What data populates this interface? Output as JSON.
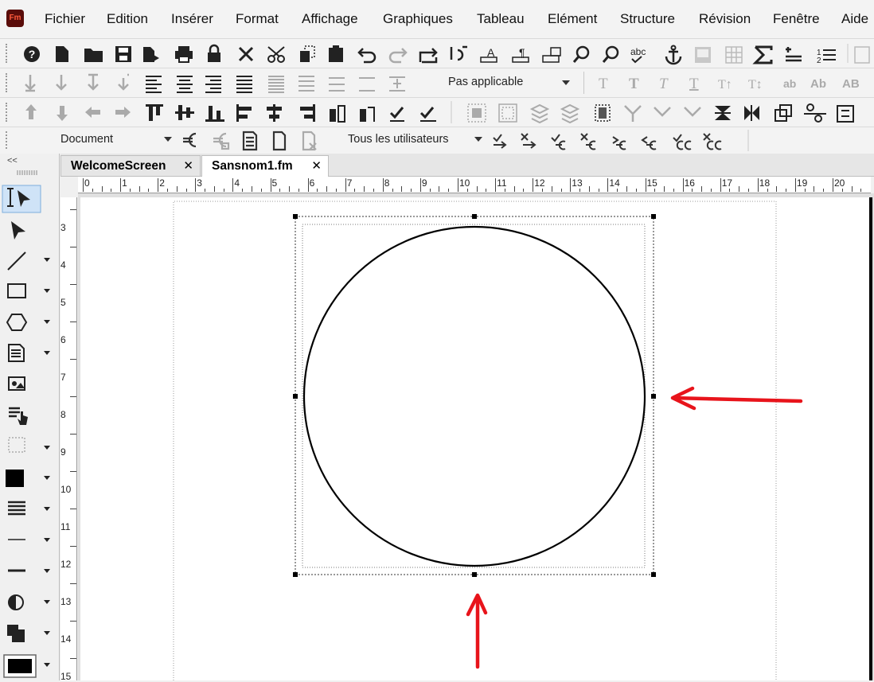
{
  "app": {
    "logo_text": "Fm"
  },
  "menu": [
    "Fichier",
    "Edition",
    "Insérer",
    "Format",
    "Affichage",
    "Graphiques",
    "Tableau",
    "Elément",
    "Structure",
    "Révision",
    "Fenêtre",
    "Aide"
  ],
  "toolbar2": {
    "para_format_value": "Pas applicable"
  },
  "toolbar4": {
    "scope_value": "Document",
    "users_value": "Tous les utilisateurs"
  },
  "tabs": [
    {
      "label": "WelcomeScreen",
      "close": "✕",
      "active": false
    },
    {
      "label": "Sansnom1.fm",
      "close": "✕",
      "active": true
    }
  ],
  "ruler": {
    "horizontal": [
      "0",
      "1",
      "2",
      "3",
      "4",
      "5",
      "6",
      "7",
      "8",
      "9",
      "10",
      "11",
      "12",
      "13",
      "14",
      "15",
      "16",
      "17",
      "18",
      "19",
      "20"
    ],
    "vertical": [
      "3",
      "4",
      "5",
      "6",
      "7",
      "8",
      "9",
      "10",
      "11",
      "12",
      "13",
      "14",
      "15"
    ]
  },
  "colors": {
    "annotation_arrow": "#e8141b",
    "accent_selected_tool": "#cfe3f7"
  }
}
